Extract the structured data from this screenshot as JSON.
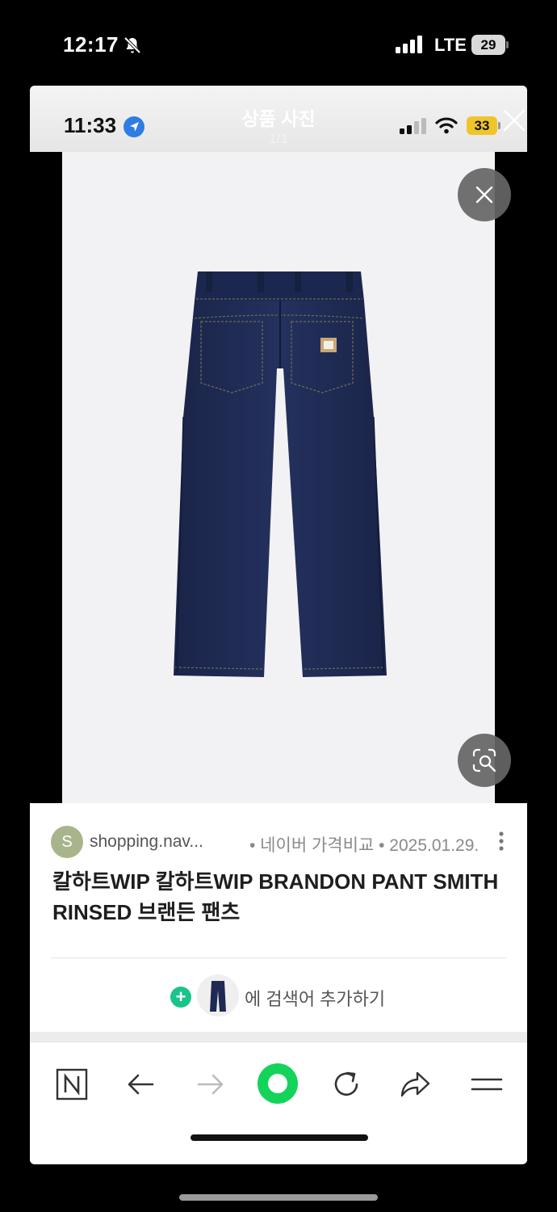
{
  "outer_status": {
    "time": "12:17",
    "network": "LTE",
    "battery": "29"
  },
  "inner_status": {
    "time": "11:33",
    "battery": "33"
  },
  "viewer": {
    "title": "상품 사진",
    "counter": "1/1"
  },
  "result": {
    "source_initial": "S",
    "source_domain": "shopping.nav...",
    "source_meta": "• 네이버 가격비교 • 2025.01.29.",
    "title": "칼하트WIP 칼하트WIP BRANDON PANT SMITH RINSED 브랜든 팬츠",
    "add_label": "에 검색어 추가하기",
    "add_icon_glyph": "+"
  },
  "colors": {
    "home_button": "#14d35a",
    "add_plus": "#19c48a",
    "inner_battery": "#f0c52c",
    "denim": "#1e2a52"
  },
  "icons": [
    "bell-off-icon",
    "location-arrow-icon",
    "signal-icon",
    "wifi-icon",
    "battery-icon",
    "close-icon",
    "visual-search-icon",
    "more-vertical-icon",
    "plus-icon",
    "naver-n-icon",
    "back-arrow-icon",
    "forward-arrow-icon",
    "green-home-icon",
    "reload-icon",
    "share-icon",
    "menu-icon"
  ]
}
